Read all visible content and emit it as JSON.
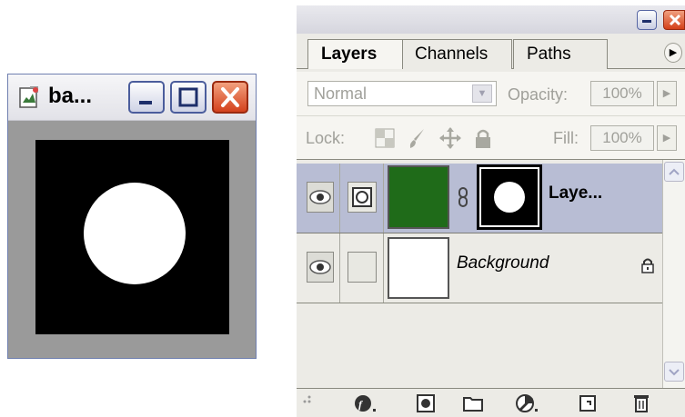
{
  "document_window": {
    "title": "ba..."
  },
  "layers_panel": {
    "tabs": [
      {
        "label": "Layers"
      },
      {
        "label": "Channels"
      },
      {
        "label": "Paths"
      }
    ],
    "blend_mode": "Normal",
    "opacity_label": "Opacity:",
    "opacity_value": "100%",
    "lock_label": "Lock:",
    "fill_label": "Fill:",
    "fill_value": "100%",
    "layers": [
      {
        "name": "Laye...",
        "selected": true,
        "fill_color": "#1f6b19",
        "has_mask": true
      },
      {
        "name": "Background",
        "selected": false,
        "locked": true
      }
    ],
    "bottom_icons": [
      "add-layer-style-icon",
      "add-mask-icon",
      "new-group-icon",
      "adjustment-layer-icon",
      "new-layer-icon",
      "delete-layer-icon"
    ]
  }
}
